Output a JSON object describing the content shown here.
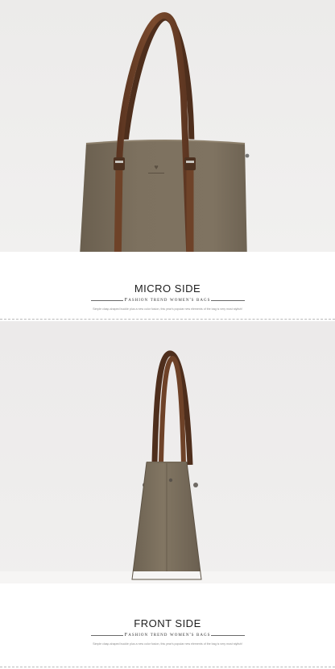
{
  "sections": [
    {
      "title": "MICRO SIDE",
      "subtitle": "Fashion trend women's bags",
      "description": "Simple clasp-shaped buckle plus a new color fusion, this year's popular new elements of the bag is very most stylish!"
    },
    {
      "title": "FRONT SIDE",
      "subtitle": "Fashion trend women's bags",
      "description": "Simple clasp-shaped buckle plus a new color fusion, this year's popular new elements of the bag is very most stylish!"
    }
  ],
  "colors": {
    "bag_body": "#7c705e",
    "bag_shadow": "#5f5446",
    "strap": "#6b4128",
    "photo_background": "#eeeceb",
    "floor": "#f7f6f5"
  }
}
